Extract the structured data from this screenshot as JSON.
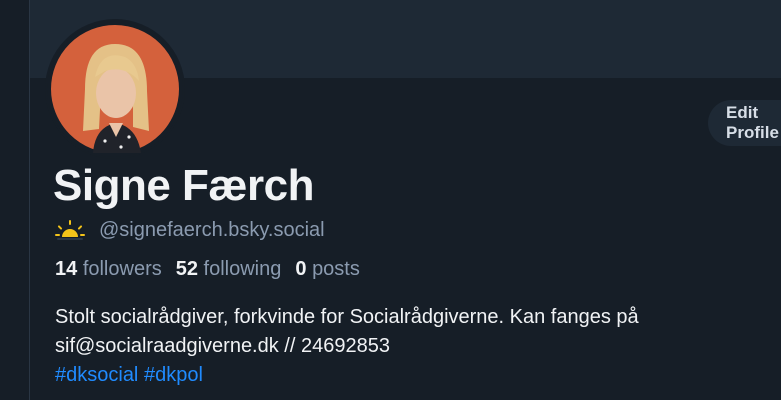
{
  "profile": {
    "display_name": "Signe Færch",
    "handle": "@signefaerch.bsky.social",
    "followers_count": "14",
    "followers_label": "followers",
    "following_count": "52",
    "following_label": "following",
    "posts_count": "0",
    "posts_label": "posts",
    "bio_line1": "Stolt socialrådgiver, forkvinde for Socialrådgiverne. Kan fanges på",
    "bio_line2": "sif@socialraadgiverne.dk // 24692853",
    "hashtags": [
      "#dksocial",
      "#dkpol"
    ]
  },
  "actions": {
    "edit_label": "Edit Profile"
  },
  "colors": {
    "background": "#161e27",
    "banner": "#1e2935",
    "text_primary": "#f1f3f5",
    "text_secondary": "#8b9bb0",
    "link": "#208bfe",
    "sun_accent": "#f3c319"
  },
  "icons": {
    "handle_prefix": "sun-icon"
  }
}
